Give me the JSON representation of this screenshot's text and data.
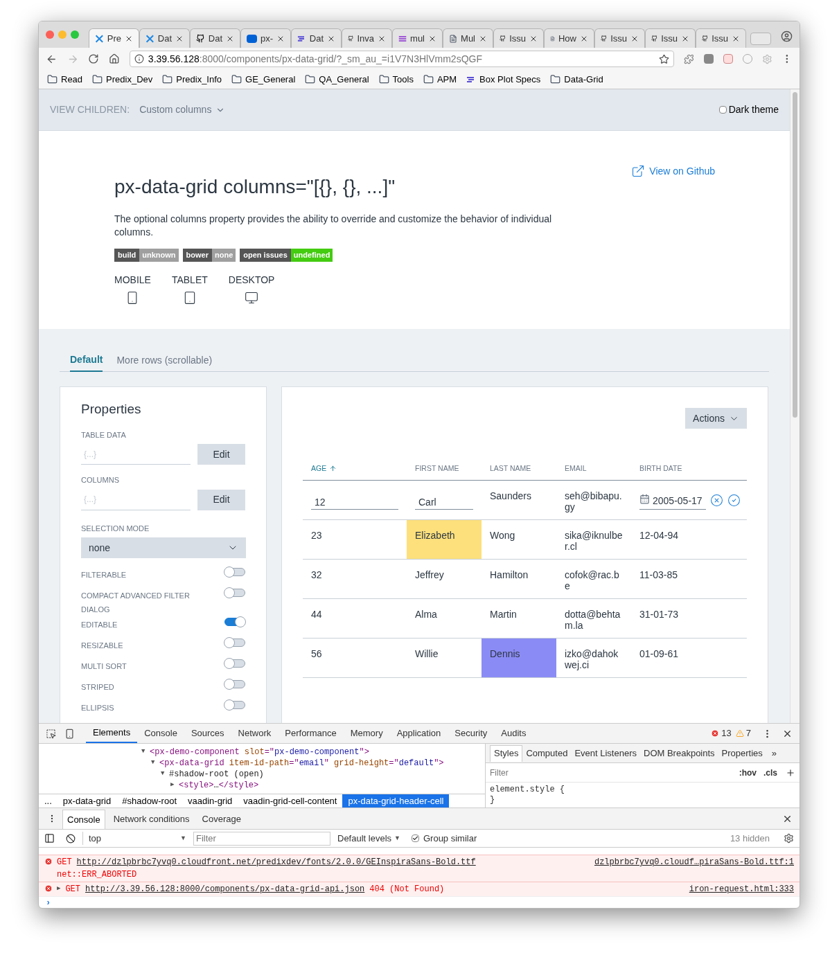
{
  "browser": {
    "tabs": [
      {
        "title": "Pre",
        "kind": "predix",
        "selected": true
      },
      {
        "title": "Dat",
        "kind": "predix",
        "selected": false
      },
      {
        "title": "Dat",
        "kind": "github",
        "selected": false
      },
      {
        "title": "px-",
        "kind": "box",
        "selected": false
      },
      {
        "title": "Dat",
        "kind": "lines",
        "selected": false
      },
      {
        "title": "Inva",
        "kind": "github",
        "selected": false
      },
      {
        "title": "mul",
        "kind": "stack",
        "selected": false
      },
      {
        "title": "Mul",
        "kind": "doc",
        "selected": false
      },
      {
        "title": "Issu",
        "kind": "github",
        "selected": false
      },
      {
        "title": "How",
        "kind": "doc",
        "selected": false
      },
      {
        "title": "Issu",
        "kind": "github",
        "selected": false
      },
      {
        "title": "Issu",
        "kind": "github",
        "selected": false
      },
      {
        "title": "Issu",
        "kind": "github",
        "selected": false
      }
    ],
    "url": {
      "host": "3.39.56.128",
      "rest": ":8000/components/px-data-grid/?_sm_au_=i1V7N3HlVmm2sQGF"
    },
    "bookmarks": [
      {
        "label": "Read",
        "kind": "folder"
      },
      {
        "label": "Predix_Dev",
        "kind": "folder"
      },
      {
        "label": "Predix_Info",
        "kind": "folder"
      },
      {
        "label": "GE_General",
        "kind": "folder"
      },
      {
        "label": "QA_General",
        "kind": "folder"
      },
      {
        "label": "Tools",
        "kind": "folder"
      },
      {
        "label": "APM",
        "kind": "folder"
      },
      {
        "label": "Box Plot Specs",
        "kind": "lines"
      },
      {
        "label": "Data-Grid",
        "kind": "folder"
      }
    ]
  },
  "page": {
    "header": {
      "label": "VIEW CHILDREN:",
      "value": "Custom columns",
      "dark_theme": {
        "label": "Dark theme",
        "checked": false
      }
    },
    "title": "px-data-grid columns=\"[{}, {}, ...]\"",
    "description": "The optional columns property provides the ability to override and customize the behavior of individual columns.",
    "github_link": "View on Github",
    "badges": [
      {
        "label": "build",
        "value": "unknown",
        "color": "#9f9f9f"
      },
      {
        "label": "bower",
        "value": "none",
        "color": "#9f9f9f"
      },
      {
        "label": "open issues",
        "value": "undefined",
        "color": "#44cc11"
      }
    ],
    "devices": [
      {
        "label": "MOBILE",
        "kind": "mobile"
      },
      {
        "label": "TABLET",
        "kind": "tablet"
      },
      {
        "label": "DESKTOP",
        "kind": "desktop"
      }
    ],
    "tabs": [
      {
        "label": "Default",
        "selected": true
      },
      {
        "label": "More rows (scrollable)",
        "selected": false
      }
    ],
    "properties": {
      "title": "Properties",
      "fields": [
        {
          "label": "TABLE DATA",
          "placeholder": "{...}",
          "button": "Edit"
        },
        {
          "label": "COLUMNS",
          "placeholder": "{...}",
          "button": "Edit"
        }
      ],
      "select": {
        "label": "SELECTION MODE",
        "value": "none"
      },
      "toggles": [
        {
          "label": "FILTERABLE",
          "on": false
        },
        {
          "label": "COMPACT ADVANCED FILTER DIALOG",
          "on": false
        },
        {
          "label": "EDITABLE",
          "on": true
        },
        {
          "label": "RESIZABLE",
          "on": false
        },
        {
          "label": "MULTI SORT",
          "on": false
        },
        {
          "label": "STRIPED",
          "on": false
        },
        {
          "label": "ELLIPSIS",
          "on": false
        }
      ]
    },
    "grid": {
      "actions": "Actions",
      "columns": [
        {
          "label": "AGE",
          "sorted": true
        },
        {
          "label": "FIRST NAME",
          "sorted": false
        },
        {
          "label": "LAST NAME",
          "sorted": false
        },
        {
          "label": "EMAIL",
          "sorted": false
        },
        {
          "label": "BIRTH DATE",
          "sorted": false
        }
      ],
      "rows": [
        {
          "cells": [
            {
              "text": "12",
              "kind": "input"
            },
            {
              "text": "Carl",
              "kind": "input"
            },
            {
              "text": "Saunders",
              "kind": "text"
            },
            {
              "text": "seh@bibapu.gy",
              "kind": "text"
            },
            {
              "text": "2005-05-17",
              "kind": "date"
            }
          ]
        },
        {
          "cells": [
            {
              "text": "23",
              "kind": "text"
            },
            {
              "text": "Elizabeth",
              "kind": "text",
              "color": "#fde07c"
            },
            {
              "text": "Wong",
              "kind": "text"
            },
            {
              "text": "sika@iknulber.cl",
              "kind": "text"
            },
            {
              "text": "12-04-94",
              "kind": "text"
            }
          ]
        },
        {
          "cells": [
            {
              "text": "32",
              "kind": "text"
            },
            {
              "text": "Jeffrey",
              "kind": "text"
            },
            {
              "text": "Hamilton",
              "kind": "text"
            },
            {
              "text": "cofok@rac.be",
              "kind": "text"
            },
            {
              "text": "11-03-85",
              "kind": "text"
            }
          ]
        },
        {
          "cells": [
            {
              "text": "44",
              "kind": "text"
            },
            {
              "text": "Alma",
              "kind": "text"
            },
            {
              "text": "Martin",
              "kind": "text"
            },
            {
              "text": "dotta@behtam.la",
              "kind": "text"
            },
            {
              "text": "31-01-73",
              "kind": "text"
            }
          ]
        },
        {
          "cells": [
            {
              "text": "56",
              "kind": "text"
            },
            {
              "text": "Willie",
              "kind": "text"
            },
            {
              "text": "Dennis",
              "kind": "text",
              "color": "#8b8bf5"
            },
            {
              "text": "izko@dahokwej.ci",
              "kind": "text"
            },
            {
              "text": "01-09-61",
              "kind": "text"
            }
          ]
        }
      ]
    }
  },
  "devtools": {
    "tabs": [
      {
        "label": "Elements",
        "selected": true
      },
      {
        "label": "Console",
        "selected": false
      },
      {
        "label": "Sources",
        "selected": false
      },
      {
        "label": "Network",
        "selected": false
      },
      {
        "label": "Performance",
        "selected": false
      },
      {
        "label": "Memory",
        "selected": false
      },
      {
        "label": "Application",
        "selected": false
      },
      {
        "label": "Security",
        "selected": false
      },
      {
        "label": "Audits",
        "selected": false
      }
    ],
    "errors": "13",
    "warnings": "7",
    "dom": [
      {
        "toggle": "▼",
        "parts": [
          {
            "t": "<px-demo-component",
            "kind": "tag"
          },
          {
            "t": " slot",
            "kind": "attr"
          },
          {
            "t": "=\"",
            "kind": "tag"
          },
          {
            "t": "px-demo-component",
            "kind": "value"
          },
          {
            "t": "\">",
            "kind": "tag"
          }
        ],
        "children": [
          {
            "toggle": "▼",
            "parts": [
              {
                "t": "<px-data-grid",
                "kind": "tag"
              },
              {
                "t": " item-id-path",
                "kind": "attr"
              },
              {
                "t": "=\"",
                "kind": "tag"
              },
              {
                "t": "email",
                "kind": "value"
              },
              {
                "t": "\"",
                "kind": "tag"
              },
              {
                "t": " grid-height",
                "kind": "attr"
              },
              {
                "t": "=\"",
                "kind": "tag"
              },
              {
                "t": "default",
                "kind": "value"
              },
              {
                "t": "\">",
                "kind": "tag"
              }
            ],
            "children": [
              {
                "toggle": "▼",
                "parts": [
                  {
                    "t": "#shadow-root (open)",
                    "kind": "plain"
                  }
                ],
                "children": [
                  {
                    "toggle": "▶",
                    "parts": [
                      {
                        "t": "<style>",
                        "kind": "tag"
                      },
                      {
                        "t": "…",
                        "kind": "plain"
                      },
                      {
                        "t": "</style>",
                        "kind": "tag"
                      }
                    ]
                  }
                ]
              }
            ]
          }
        ]
      }
    ],
    "breadcrumbs": [
      {
        "label": "...",
        "selected": false
      },
      {
        "label": "px-data-grid",
        "selected": false
      },
      {
        "label": "#shadow-root",
        "selected": false
      },
      {
        "label": "vaadin-grid",
        "selected": false
      },
      {
        "label": "vaadin-grid-cell-content",
        "selected": false
      },
      {
        "label": "px-data-grid-header-cell",
        "selected": true
      }
    ],
    "styles_tabs": [
      {
        "label": "Styles",
        "selected": true
      },
      {
        "label": "Computed",
        "selected": false
      },
      {
        "label": "Event Listeners",
        "selected": false
      },
      {
        "label": "DOM Breakpoints",
        "selected": false
      },
      {
        "label": "Properties",
        "selected": false
      }
    ],
    "styles_more": "»",
    "styles_filter": {
      "placeholder": "Filter"
    },
    "hov": ":hov",
    "cls": ".cls",
    "rule_open": "element.style {",
    "rule_close": "}",
    "drawer_tabs": [
      {
        "label": "Console",
        "selected": true
      },
      {
        "label": "Network conditions",
        "selected": false
      },
      {
        "label": "Coverage",
        "selected": false
      }
    ],
    "console_toolbar": {
      "context": "top",
      "context_arrow": "▼",
      "filter": {
        "placeholder": "Filter"
      },
      "levels": "Default levels",
      "levels_arrow": "▼",
      "group_similar": {
        "label": "Group similar",
        "checked": true
      },
      "hidden": "13 hidden"
    },
    "messages": [
      {
        "kind": "error",
        "method": "GET",
        "url": "http://dzlpbrbc7yvq0.cloudfront.net/predixdev/fonts/2.0.0/GEInspiraSans-Bold.ttf",
        "extra": "net::ERR_ABORTED",
        "source": "dzlpbrbc7yvq0.cloudf…piraSans-Bold.ttf:1"
      },
      {
        "kind": "error",
        "toggle": "▶",
        "method": "GET",
        "url": "http://3.39.56.128:8000/components/px-data-grid-api.json",
        "status": "404 (Not Found)",
        "source": "iron-request.html:333"
      }
    ],
    "prompt": "›"
  }
}
